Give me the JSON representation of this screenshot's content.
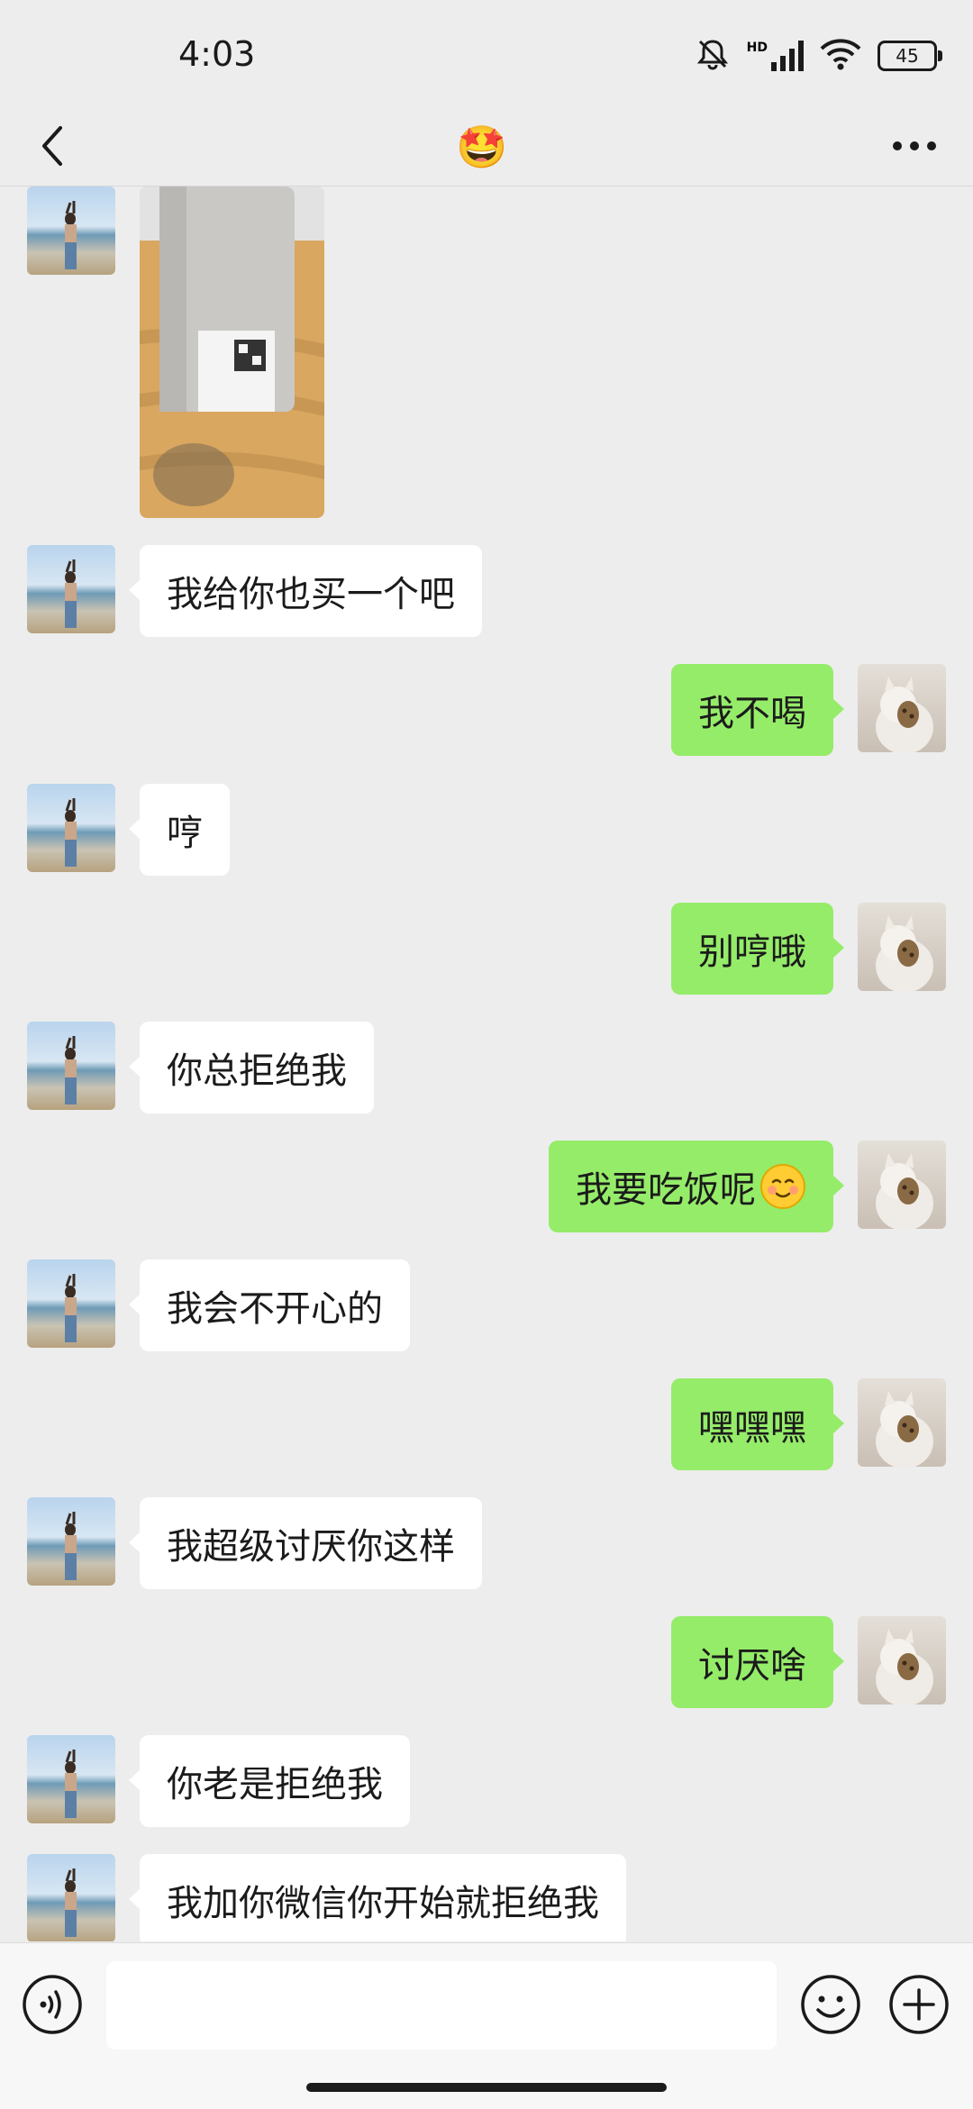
{
  "status_bar": {
    "time": "4:03",
    "network": "HD",
    "battery": "45"
  },
  "header": {
    "title_emoji": "🤩"
  },
  "messages": [
    {
      "side": "in",
      "type": "image",
      "text": ""
    },
    {
      "side": "in",
      "text": "我给你也买一个吧"
    },
    {
      "side": "out",
      "text": "我不喝"
    },
    {
      "side": "in",
      "text": "哼"
    },
    {
      "side": "out",
      "text": "别哼哦"
    },
    {
      "side": "in",
      "text": "你总拒绝我"
    },
    {
      "side": "out",
      "text": "我要吃饭呢",
      "emoji": "☺️"
    },
    {
      "side": "in",
      "text": "我会不开心的"
    },
    {
      "side": "out",
      "text": "嘿嘿嘿"
    },
    {
      "side": "in",
      "text": "我超级讨厌你这样"
    },
    {
      "side": "out",
      "text": "讨厌啥"
    },
    {
      "side": "in",
      "text": "你老是拒绝我"
    },
    {
      "side": "in",
      "text": "我加你微信你开始就拒绝我"
    }
  ],
  "input": {
    "placeholder": ""
  },
  "colors": {
    "incoming": "#ffffff",
    "outgoing": "#95ec69",
    "background": "#ededed"
  },
  "icons": {
    "back": "chevron-left-icon",
    "more": "more-dots-icon",
    "voice": "voice-icon",
    "emoji": "emoji-icon",
    "plus": "plus-icon"
  }
}
